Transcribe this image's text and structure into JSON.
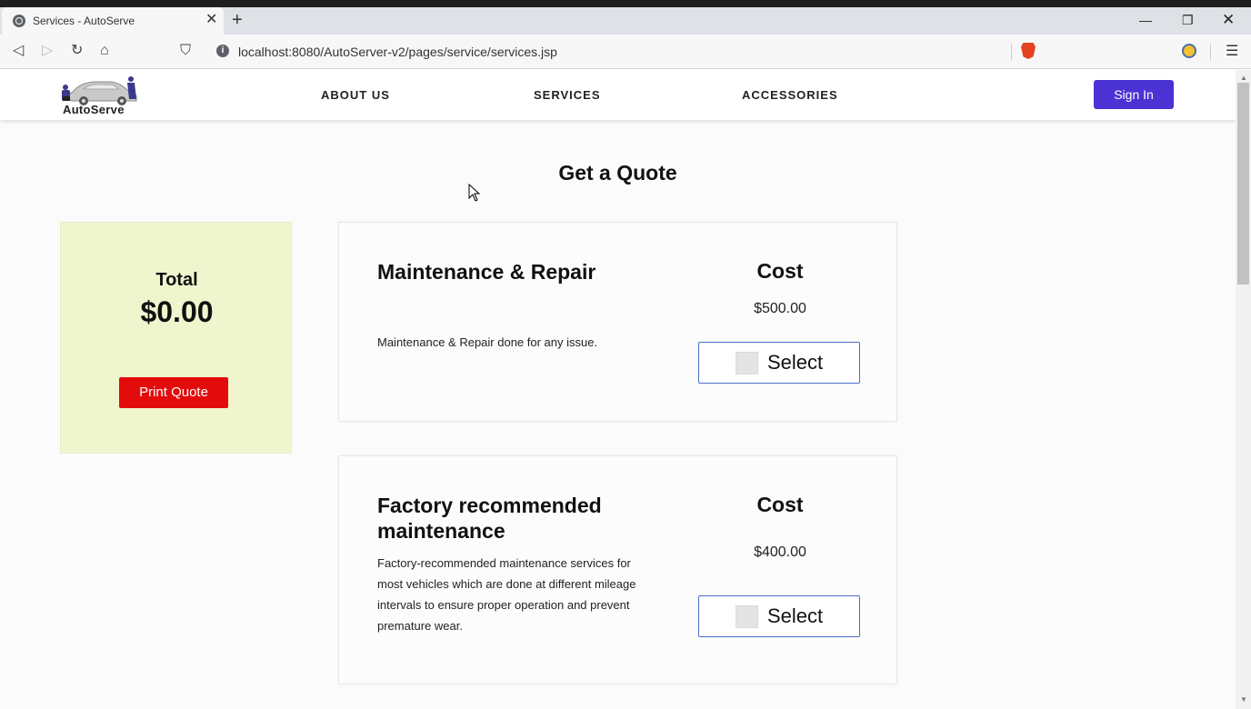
{
  "browser": {
    "tab_title": "Services - AutoServe",
    "tab_close": "✕",
    "new_tab": "+",
    "url": "localhost:8080/AutoServer-v2/pages/service/services.jsp",
    "window_min": "—",
    "window_max": "❐",
    "window_close": "✕",
    "back": "◁",
    "forward": "▷",
    "reload": "↻",
    "home": "⌂",
    "bookmark": "⛉",
    "menu": "☰",
    "info": "i"
  },
  "navbar": {
    "logo_text": "AutoServe",
    "links": [
      "ABOUT US",
      "SERVICES",
      "ACCESSORIES"
    ],
    "signin_label": "Sign In"
  },
  "page": {
    "title": "Get a Quote"
  },
  "quote": {
    "total_label": "Total",
    "total_value": "$0.00",
    "print_label": "Print Quote"
  },
  "services": [
    {
      "name": "Maintenance & Repair",
      "description": "Maintenance & Repair done for any issue.",
      "cost_label": "Cost",
      "cost": "$500.00",
      "select_label": "Select"
    },
    {
      "name": "Factory recommended maintenance",
      "description": "Factory-recommended maintenance services for most vehicles which are done at different mileage intervals to ensure proper operation and prevent premature wear.",
      "cost_label": "Cost",
      "cost": "$400.00",
      "select_label": "Select"
    }
  ],
  "colors": {
    "signin_bg": "#4a32d4",
    "print_bg": "#e30b0b",
    "total_box_bg": "#eff5cd",
    "select_border": "#4a6fc9"
  }
}
